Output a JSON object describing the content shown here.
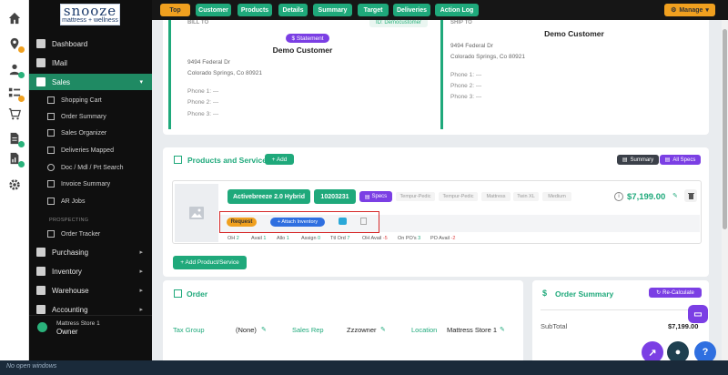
{
  "logo": {
    "main": "snooze",
    "sub": "mattress + wellness"
  },
  "topbar": {
    "buttons": [
      "Top",
      "Customer",
      "Products",
      "Details",
      "Summary",
      "Target",
      "Deliveries",
      "Action Log"
    ],
    "manage": "Manage"
  },
  "sidebar": {
    "items": {
      "dashboard": "Dashboard",
      "imail": "IMail",
      "sales": "Sales",
      "purchasing": "Purchasing",
      "inventory": "Inventory",
      "warehouse": "Warehouse",
      "accounting": "Accounting"
    },
    "sales_sub": [
      "Shopping Cart",
      "Order Summary",
      "Sales Organizer",
      "Deliveries Mapped",
      "Doc / Mdl / Prt Search",
      "Invoice Summary",
      "AR Jobs"
    ],
    "prospecting_label": "PROSPECTING",
    "prospecting_sub": [
      "Order Tracker"
    ],
    "store_name": "Mattress Store 1",
    "store_role": "Owner"
  },
  "bill_to": {
    "title": "BILL TO",
    "id_pill": "ID: Democustomer",
    "badge": "$ Statement",
    "name": "Demo Customer",
    "address1": "9494 Federal Dr",
    "address2": "Colorado Springs, Co 80921",
    "phones": [
      "Phone 1: ---",
      "Phone 2: ---",
      "Phone 3: ---"
    ]
  },
  "ship_to": {
    "title": "SHIP TO",
    "name": "Demo Customer",
    "address1": "9494 Federal Dr",
    "address2": "Colorado Springs, Co 80921",
    "phones": [
      "Phone 1: ---",
      "Phone 2: ---",
      "Phone 3: ---"
    ]
  },
  "products": {
    "title": "Products and Services",
    "add": "+ Add",
    "summary_btn": "Summary",
    "all_specs_btn": "All Specs",
    "item_name": "Activebreeze 2.0 Hybrid",
    "item_code": "10203231",
    "specs_btn": "Specs",
    "tags": [
      "Tempur-Pedic",
      "Tempur-Pedic",
      "Mattress",
      "Twin XL",
      "Medium"
    ],
    "price": "$7,199.00",
    "request": "Request",
    "attach": "+ Attach Inventory",
    "stats": [
      {
        "label": "OH",
        "value": "2",
        "neg": false
      },
      {
        "label": "Avail",
        "value": "1",
        "neg": false
      },
      {
        "label": "Allo",
        "value": "1",
        "neg": false
      },
      {
        "label": "Assign",
        "value": "0",
        "neg": false
      },
      {
        "label": "Ttl Ord",
        "value": "7",
        "neg": false
      },
      {
        "label": "OH Avail",
        "value": "-5",
        "neg": true
      },
      {
        "label": "On PO's",
        "value": "3",
        "neg": false
      },
      {
        "label": "PO Avail",
        "value": "-2",
        "neg": true
      }
    ],
    "add_product": "+ Add Product/Service"
  },
  "order": {
    "title": "Order",
    "tax_group_label": "Tax Group",
    "tax_group_value": "(None)",
    "sales_rep_label": "Sales Rep",
    "sales_rep_value": "Zzzowner",
    "location_label": "Location",
    "location_value": "Mattress Store 1"
  },
  "order_summary": {
    "title": "Order Summary",
    "recalc": "Re-Calculate",
    "subtotal_label": "SubTotal",
    "subtotal_value": "$7,199.00"
  },
  "taskbar": {
    "text": "No open windows"
  },
  "colors": {
    "brand_green": "#1fa97b",
    "accent_purple": "#7b3fe4",
    "accent_orange": "#f0a01f",
    "highlight_red": "#d62828"
  }
}
